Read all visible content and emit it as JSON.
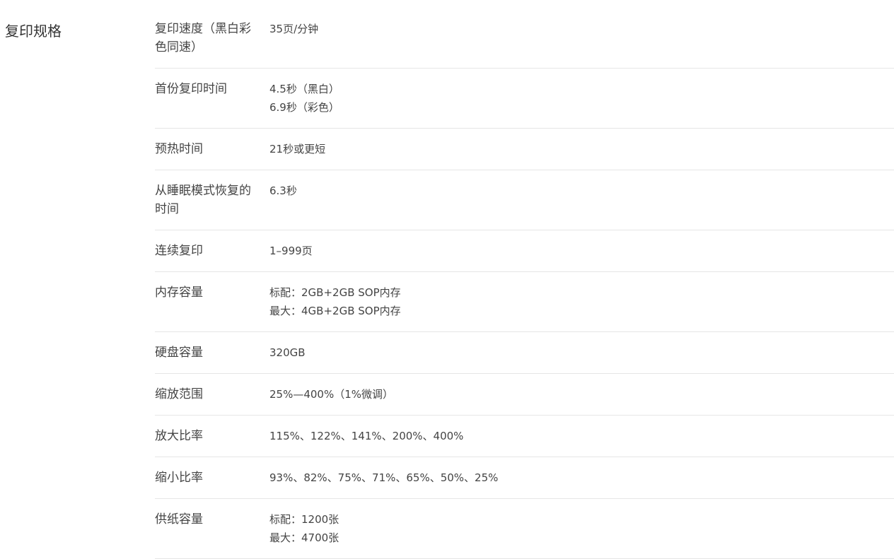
{
  "section": {
    "title": "复印规格"
  },
  "specs": [
    {
      "label": "复印速度（黑白彩色同速）",
      "values": [
        "35页/分钟"
      ]
    },
    {
      "label": "首份复印时间",
      "values": [
        "4.5秒（黑白）",
        "6.9秒（彩色）"
      ]
    },
    {
      "label": "预热时间",
      "values": [
        "21秒或更短"
      ]
    },
    {
      "label": "从睡眠模式恢复的时间",
      "values": [
        "6.3秒"
      ]
    },
    {
      "label": "连续复印",
      "values": [
        "1–999页"
      ]
    },
    {
      "label": "内存容量",
      "values": [
        "标配：2GB+2GB SOP内存",
        "最大：4GB+2GB SOP内存"
      ]
    },
    {
      "label": "硬盘容量",
      "values": [
        "320GB"
      ]
    },
    {
      "label": "缩放范围",
      "values": [
        "25%—400%（1%微调）"
      ]
    },
    {
      "label": "放大比率",
      "values": [
        "115%、122%、141%、200%、400%"
      ]
    },
    {
      "label": "缩小比率",
      "values": [
        "93%、82%、75%、71%、65%、50%、25%"
      ]
    },
    {
      "label": "供纸容量",
      "values": [
        "标配：1200张",
        "最大：4700张"
      ]
    }
  ]
}
